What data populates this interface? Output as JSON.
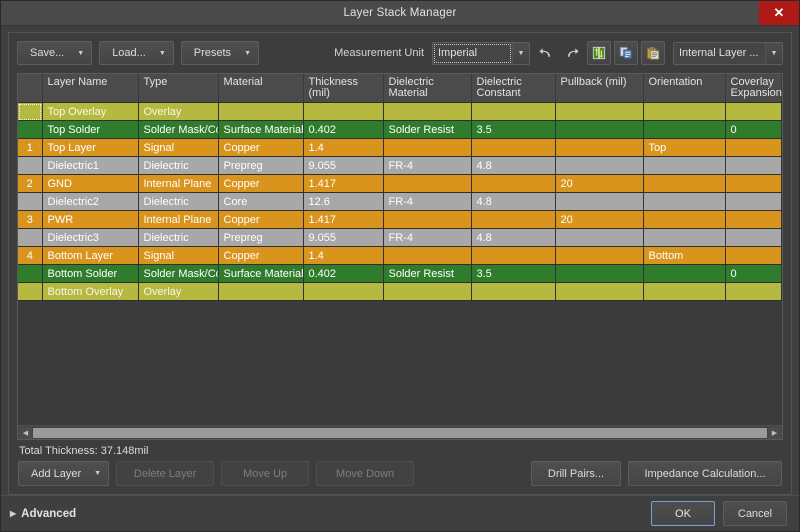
{
  "window": {
    "title": "Layer Stack Manager",
    "close_label": "✕"
  },
  "toolbar": {
    "save_label": "Save...",
    "load_label": "Load...",
    "presets_label": "Presets",
    "measurement_unit_label": "Measurement Unit",
    "measurement_unit_value": "Imperial",
    "undo_icon": "undo-icon",
    "redo_icon": "redo-icon",
    "layer_pairs_icon": "move-layer-icon",
    "copy_icon": "copy-icon",
    "paste_icon": "paste-icon",
    "internal_layer_value": "Internal Layer ..."
  },
  "table": {
    "columns": [
      "",
      "Layer Name",
      "Type",
      "Material",
      "Thickness (mil)",
      "Dielectric Material",
      "Dielectric Constant",
      "Pullback (mil)",
      "Orientation",
      "Coverlay Expansion"
    ],
    "rows": [
      {
        "index": "",
        "name": "Top Overlay",
        "type": "Overlay",
        "material": "",
        "thickness": "",
        "dielectric_material": "",
        "dielectric_constant": "",
        "pullback": "",
        "orientation": "",
        "coverlay": "",
        "style": "row-overlay",
        "focused": true
      },
      {
        "index": "",
        "name": "Top Solder",
        "type": "Solder Mask/Co...",
        "material": "Surface Material",
        "thickness": "0.402",
        "dielectric_material": "Solder Resist",
        "dielectric_constant": "3.5",
        "pullback": "",
        "orientation": "",
        "coverlay": "0",
        "style": "row-solder",
        "focused": false
      },
      {
        "index": "1",
        "name": "Top Layer",
        "type": "Signal",
        "material": "Copper",
        "thickness": "1.4",
        "dielectric_material": "",
        "dielectric_constant": "",
        "pullback": "",
        "orientation": "Top",
        "coverlay": "",
        "style": "row-signal",
        "focused": false
      },
      {
        "index": "",
        "name": "Dielectric1",
        "type": "Dielectric",
        "material": "Prepreg",
        "thickness": "9.055",
        "dielectric_material": "FR-4",
        "dielectric_constant": "4.8",
        "pullback": "",
        "orientation": "",
        "coverlay": "",
        "style": "row-diel",
        "focused": false
      },
      {
        "index": "2",
        "name": "GND",
        "type": "Internal Plane",
        "material": "Copper",
        "thickness": "1.417",
        "dielectric_material": "",
        "dielectric_constant": "",
        "pullback": "20",
        "orientation": "",
        "coverlay": "",
        "style": "row-plane",
        "focused": false
      },
      {
        "index": "",
        "name": "Dielectric2",
        "type": "Dielectric",
        "material": "Core",
        "thickness": "12.6",
        "dielectric_material": "FR-4",
        "dielectric_constant": "4.8",
        "pullback": "",
        "orientation": "",
        "coverlay": "",
        "style": "row-diel",
        "focused": false
      },
      {
        "index": "3",
        "name": "PWR",
        "type": "Internal Plane",
        "material": "Copper",
        "thickness": "1.417",
        "dielectric_material": "",
        "dielectric_constant": "",
        "pullback": "20",
        "orientation": "",
        "coverlay": "",
        "style": "row-plane",
        "focused": false
      },
      {
        "index": "",
        "name": "Dielectric3",
        "type": "Dielectric",
        "material": "Prepreg",
        "thickness": "9.055",
        "dielectric_material": "FR-4",
        "dielectric_constant": "4.8",
        "pullback": "",
        "orientation": "",
        "coverlay": "",
        "style": "row-diel",
        "focused": false
      },
      {
        "index": "4",
        "name": "Bottom Layer",
        "type": "Signal",
        "material": "Copper",
        "thickness": "1.4",
        "dielectric_material": "",
        "dielectric_constant": "",
        "pullback": "",
        "orientation": "Bottom",
        "coverlay": "",
        "style": "row-signal",
        "focused": false
      },
      {
        "index": "",
        "name": "Bottom Solder",
        "type": "Solder Mask/Co...",
        "material": "Surface Material",
        "thickness": "0.402",
        "dielectric_material": "Solder Resist",
        "dielectric_constant": "3.5",
        "pullback": "",
        "orientation": "",
        "coverlay": "0",
        "style": "row-solder",
        "focused": false
      },
      {
        "index": "",
        "name": "Bottom Overlay",
        "type": "Overlay",
        "material": "",
        "thickness": "",
        "dielectric_material": "",
        "dielectric_constant": "",
        "pullback": "",
        "orientation": "",
        "coverlay": "",
        "style": "row-overlay",
        "focused": false
      }
    ]
  },
  "footer": {
    "total_thickness": "Total Thickness: 37.148mil",
    "add_layer_label": "Add Layer",
    "delete_layer_label": "Delete Layer",
    "move_up_label": "Move Up",
    "move_down_label": "Move Down",
    "drill_pairs_label": "Drill Pairs...",
    "impedance_label": "Impedance Calculation..."
  },
  "bottom": {
    "advanced_label": "Advanced",
    "advanced_triangle": "▶",
    "ok_label": "OK",
    "cancel_label": "Cancel"
  },
  "colors": {
    "overlay": "#b5b940",
    "solder": "#2f7d2c",
    "signal": "#d9941e",
    "dielectric": "#a8a8a8",
    "close": "#b01a14"
  }
}
